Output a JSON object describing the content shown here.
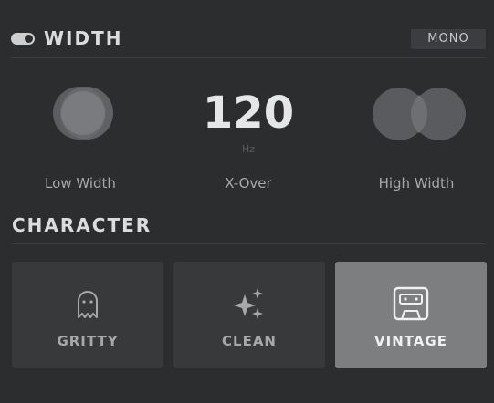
{
  "width_section": {
    "title": "WIDTH",
    "enabled": true,
    "mono_label": "MONO",
    "controls": [
      {
        "label": "Low Width"
      },
      {
        "label": "X-Over",
        "value": "120",
        "unit": "Hz"
      },
      {
        "label": "High Width"
      }
    ]
  },
  "character_section": {
    "title": "CHARACTER",
    "options": [
      {
        "label": "GRITTY",
        "icon": "ghost-icon",
        "selected": false
      },
      {
        "label": "CLEAN",
        "icon": "sparkles-icon",
        "selected": false
      },
      {
        "label": "VINTAGE",
        "icon": "cassette-icon",
        "selected": true
      }
    ]
  },
  "colors": {
    "background": "#2c2d2f",
    "button_bg": "#38393b",
    "button_active_bg": "#7d7e80"
  }
}
